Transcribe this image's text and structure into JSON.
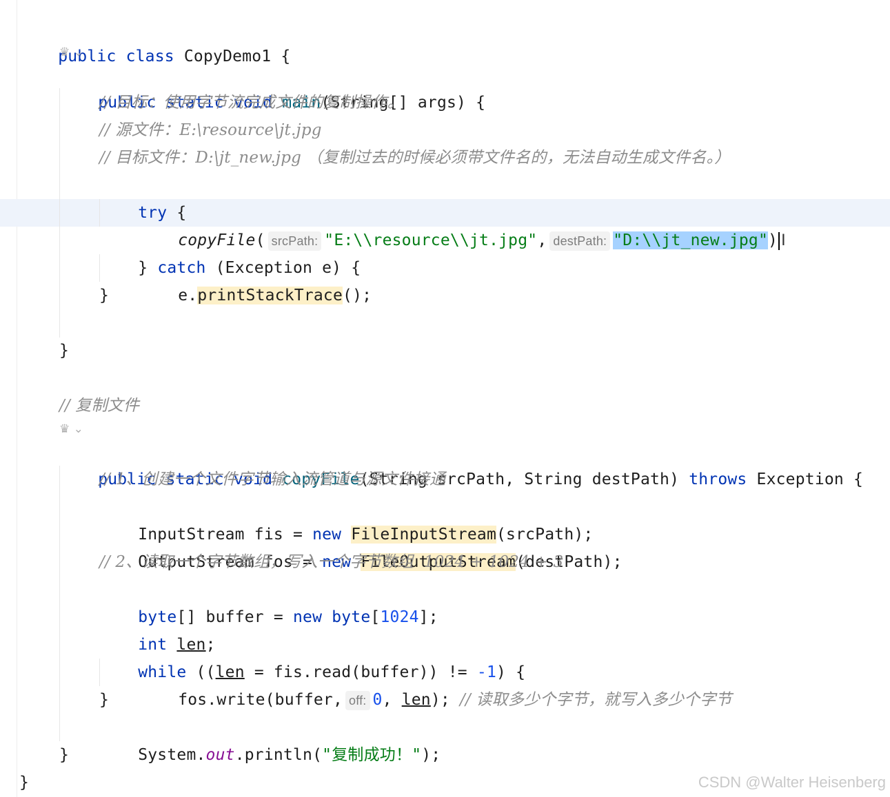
{
  "code": {
    "class_decl": {
      "kw1": "public",
      "kw2": "class",
      "name": "CopyDemo1",
      "brace": " {"
    },
    "gutter_icon_1": "♛ ⌄",
    "main_decl": {
      "kw1": "public",
      "kw2": "static",
      "kw3": "void",
      "name": "main",
      "params": "(String[] args) {"
    },
    "comment_1": "// 目标：使用字节流完成文件的复制操作。",
    "comment_2": "// 源文件：E:\\resource\\jt.jpg",
    "comment_3": "// 目标文件：D:\\jt_new.jpg （复制过去的时候必须带文件名的，无法自动生成文件名。）",
    "try_kw": "try",
    "try_brace": " {",
    "copy_call": {
      "name": "copyFile",
      "open": "(",
      "hint_src": "srcPath:",
      "src_arg": "\"E:\\\\resource\\\\jt.jpg\"",
      "comma": ",",
      "hint_dest": "destPath:",
      "dest_arg": "\"D:\\\\jt_new.jpg\"",
      "close": ")"
    },
    "catch_line": {
      "brace_open": "} ",
      "kw": "catch",
      "rest": " (Exception e) {"
    },
    "print_line": {
      "obj": "e.",
      "method": "printStackTrace",
      "rest": "();"
    },
    "brace_close": "}",
    "comment_copy": "// 复制文件",
    "gutter_icon_2": "♛ ⌄",
    "copy_decl": {
      "kw1": "public",
      "kw2": "static",
      "kw3": "void",
      "name": "copyFile",
      "params": "(String srcPath, String destPath) ",
      "throws_kw": "throws",
      "rest": " Exception {"
    },
    "comment_step1": "// 1、创建一个文件字节输入流管道与源文件接通",
    "is_line": {
      "pre": "InputStream fis = ",
      "kw": "new",
      "sp": " ",
      "ctor": "FileInputStream",
      "rest": "(srcPath);"
    },
    "os_line": {
      "pre": "OutputStream fos = ",
      "kw": "new",
      "sp": " ",
      "ctor": "FileOutputStream",
      "rest": "(destPath);"
    },
    "comment_step2": "// 2、读取一个字节数组，写入一个字节数组  1024 + 1024 + 3",
    "buf_line": {
      "kw1": "byte",
      "mid": "[] buffer = ",
      "kw2": "new",
      "kw3": "byte",
      "open": "[",
      "num": "1024",
      "close": "];"
    },
    "len_line": {
      "kw": "int",
      "sp": " ",
      "var": "len",
      "end": ";"
    },
    "while_line": {
      "kw": "while",
      "a": " ((",
      "var": "len",
      "b": " = fis.read(buffer)) != ",
      "num": "-1",
      "c": ") {"
    },
    "write_line": {
      "pre": "fos.write(buffer,",
      "hint_off": "off:",
      "num": "0",
      "sep": ", ",
      "var": "len",
      "end": ");",
      "comment": "// 读取多少个字节，就写入多少个字节"
    },
    "print_ok": {
      "pre": "System.",
      "field": "out",
      "mid": ".println(",
      "str": "\"复制成功！\"",
      "end": ");"
    }
  },
  "watermark": "CSDN @Walter Heisenberg"
}
